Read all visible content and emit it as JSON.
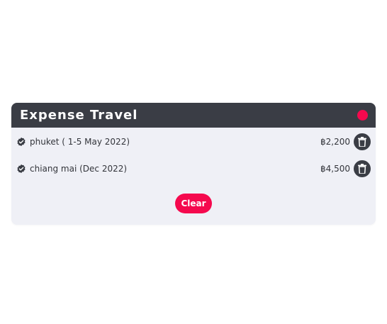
{
  "card": {
    "title": "Expense Travel",
    "close_dot_color": "#f5094e",
    "header_color": "#3a3d45",
    "body_color": "#eff0f6"
  },
  "items": [
    {
      "label": "phuket ( 1-5 May 2022)",
      "amount": "฿2,200",
      "icon": "check-badge-icon"
    },
    {
      "label": "chiang mai (Dec 2022)",
      "amount": "฿4,500",
      "icon": "check-badge-icon"
    }
  ],
  "actions": {
    "clear_label": "Clear",
    "delete_icon": "trash-icon"
  },
  "colors": {
    "accent": "#f5094e",
    "dark": "#3a3d45"
  }
}
